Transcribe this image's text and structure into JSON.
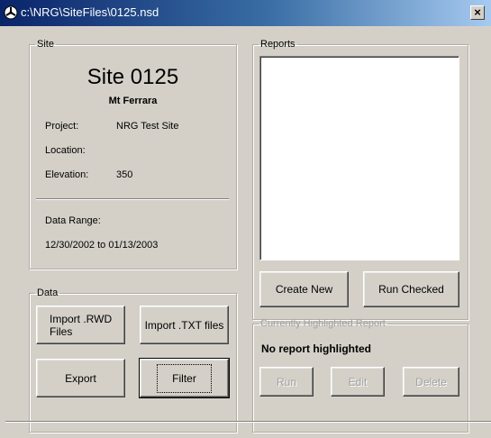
{
  "window": {
    "title": "c:\\NRG\\SiteFiles\\0125.nsd",
    "close_label": "×"
  },
  "site_group": {
    "legend": "Site",
    "site_name": "Site 0125",
    "site_subtitle": "Mt Ferrara",
    "project_label": "Project:",
    "project_value": "NRG Test Site",
    "location_label": "Location:",
    "location_value": "",
    "elevation_label": "Elevation:",
    "elevation_value": "350",
    "data_range_label": "Data Range:",
    "data_range_value": "12/30/2002 to 01/13/2003"
  },
  "data_group": {
    "legend": "Data",
    "import_rwd_label": "Import .RWD Files",
    "import_txt_label": "Import .TXT files",
    "export_label": "Export",
    "filter_label": "Filter"
  },
  "reports_group": {
    "legend": "Reports",
    "items": [],
    "create_new_label": "Create New",
    "run_checked_label": "Run Checked"
  },
  "highlighted_group": {
    "legend": "Currently Highlighted Report",
    "status": "No report highlighted",
    "run_label": "Run",
    "edit_label": "Edit",
    "delete_label": "Delete"
  },
  "colors": {
    "titlebar_start": "#0a246a",
    "titlebar_end": "#a6caf0",
    "face": "#d4d0c8"
  }
}
